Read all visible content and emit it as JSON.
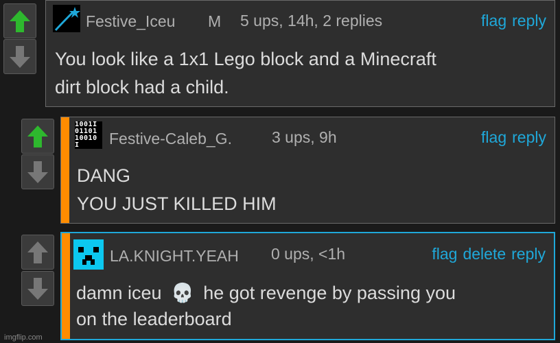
{
  "comments": [
    {
      "username": "Festive_Iceu",
      "badge": "M",
      "meta": "5 ups, 14h, 2 replies",
      "actions": [
        "flag",
        "reply"
      ],
      "text_lines": [
        "You look like a 1x1 Lego block and a Minecraft",
        "dirt block had a child."
      ]
    },
    {
      "username": "Festive-Caleb_G.",
      "meta": "3 ups, 9h",
      "actions": [
        "flag",
        "reply"
      ],
      "avatar_binary": [
        "1001I",
        "01101",
        "10010",
        "I    "
      ],
      "text_lines": [
        "DANG",
        "YOU JUST KILLED HIM"
      ]
    },
    {
      "username": "LA.KNIGHT.YEAH",
      "meta": "0 ups, <1h",
      "actions": [
        "flag",
        "delete",
        "reply"
      ],
      "text_lines": [
        "damn iceu",
        "he got revenge by passing you",
        "on the leaderboard"
      ],
      "emoji": "💀"
    }
  ],
  "colors": {
    "accent": "#1fa8d9",
    "orange": "#ff8c00",
    "upvote": "#2eb82e",
    "arrow": "#777777"
  },
  "footer": "imgflip.com"
}
